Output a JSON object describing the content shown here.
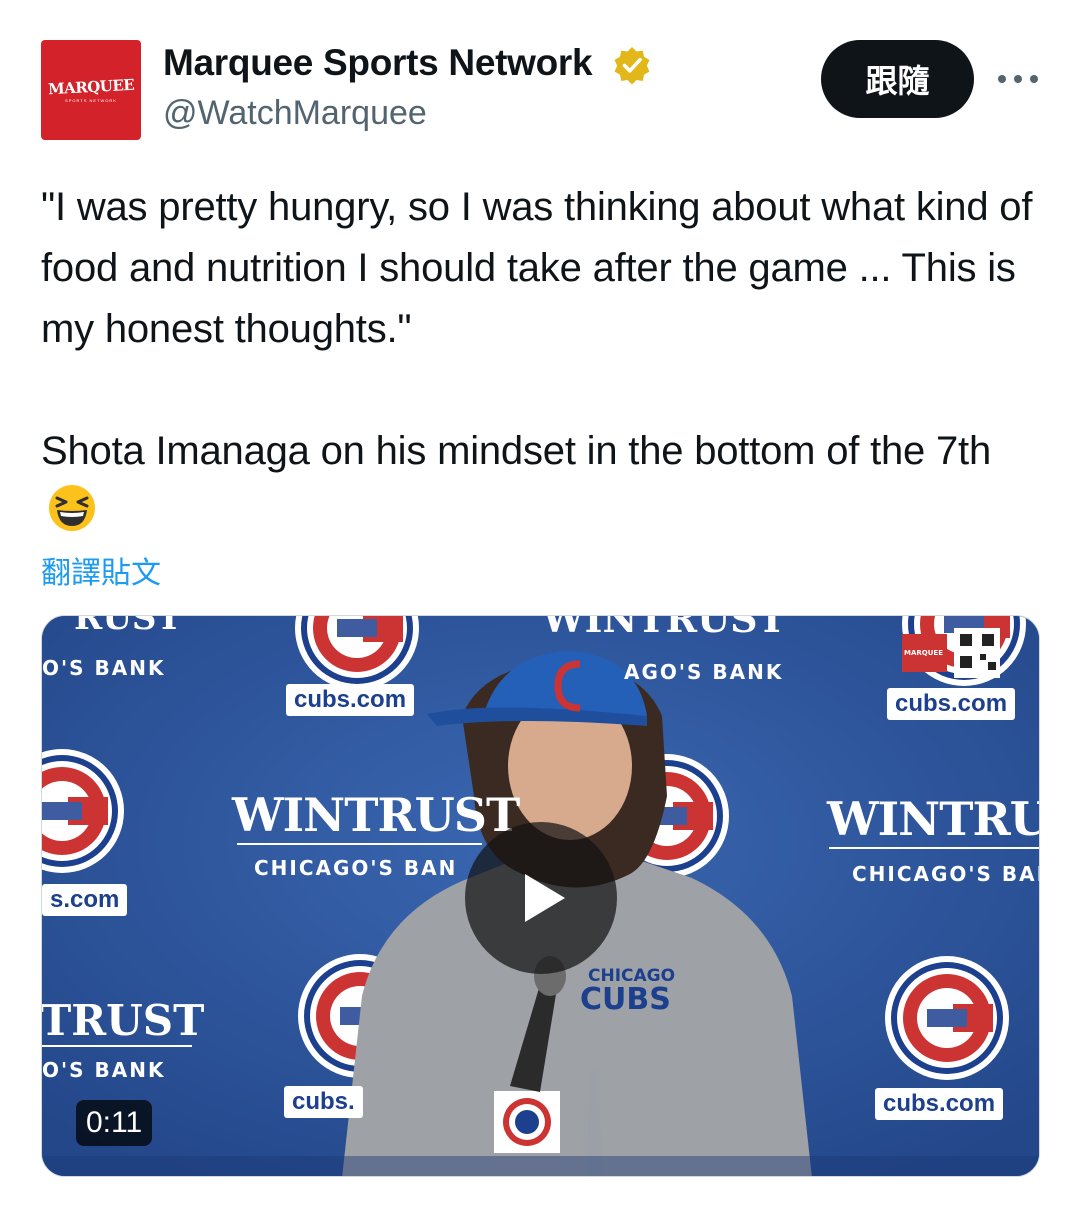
{
  "author": {
    "name": "Marquee Sports Network",
    "handle": "@WatchMarquee",
    "avatar_text": "MARQUEE",
    "avatar_subtext": "SPORTS NETWORK",
    "verified_icon": "verified-badge-gold"
  },
  "actions": {
    "follow_label": "跟隨",
    "more_icon": "more-horizontal-icon"
  },
  "tweet": {
    "text": "\"I was pretty hungry, so I was thinking about what kind of food and nutrition I should take after the game ... This is my honest thoughts.\"\n\nShota Imanaga on his mindset in the bottom of the 7th",
    "emoji": "grinning-squinting-face",
    "translate_label": "翻譯貼文"
  },
  "video": {
    "duration": "0:11",
    "backdrop": {
      "wintrust": "WINTRUST",
      "wintrust_partial_left": "TRUST",
      "wintrust_partial_top_left": "RUST",
      "bank_full": "CHICAGO'S BANK",
      "bank_partial_1": "CHICAGO'S BAN",
      "bank_partial_2": "O'S BANK",
      "bank_partial_top": "AGO'S BANK",
      "wintrust_partial_right": "WINTRUS",
      "cubs_com": "cubs.com",
      "cubs_com_partial_left": "s.com",
      "cubs_com_partial_bottom": "cubs.",
      "shirt_line1": "CHICAGO",
      "shirt_line2": "CUBS",
      "bug_label": "MARQUEE"
    }
  },
  "colors": {
    "follow_bg": "#0f1419",
    "link_blue": "#1d9bf0",
    "brand_red": "#d3222a",
    "wall_blue": "#2a4f93",
    "cubs_red": "#cc3433"
  }
}
